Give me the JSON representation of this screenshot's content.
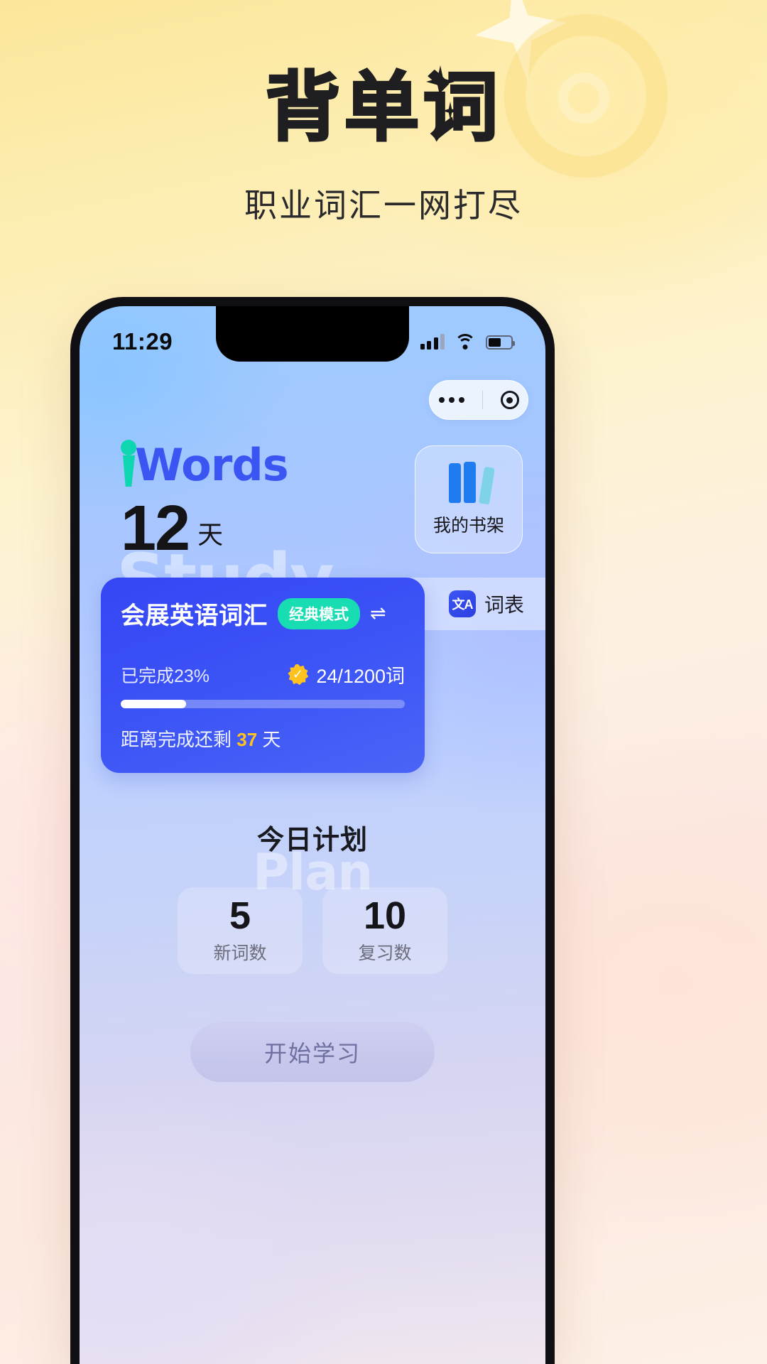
{
  "hero": {
    "title": "背单词",
    "subtitle": "职业词汇一网打尽"
  },
  "phone": {
    "statusbar": {
      "time": "11:29",
      "signal_icon": "signal-bars-icon",
      "wifi_icon": "wifi-icon",
      "battery_icon": "battery-icon"
    },
    "capsule": {
      "menu_icon": "more-dots-icon",
      "target_icon": "target-circle-icon"
    },
    "brand": {
      "logo_i": "i",
      "logo_word": "Words",
      "watermark": "Study",
      "streak_number": "12",
      "streak_unit": "天"
    },
    "shelf": {
      "label": "我的书架",
      "icon": "books-icon"
    },
    "wordlist_tab": {
      "icon_text": "文A",
      "label": "词表"
    },
    "course": {
      "title": "会展英语词汇",
      "mode_badge": "经典模式",
      "swap_icon": "⇌",
      "completed_label": "已完成23%",
      "progress_percent": 23,
      "count_label": "24/1200词",
      "star_icon": "gold-check-star-icon",
      "remain_prefix": "距离完成还剩",
      "remain_days": "37",
      "remain_suffix": "天",
      "card_color": "#3b53f6",
      "badge_color": "#18dcb2",
      "accent_color": "#ffc21f"
    },
    "plan": {
      "title": "今日计划",
      "watermark": "Plan",
      "stats": [
        {
          "value": "5",
          "label": "新词数"
        },
        {
          "value": "10",
          "label": "复习数"
        }
      ],
      "start_button": "开始学习"
    }
  }
}
